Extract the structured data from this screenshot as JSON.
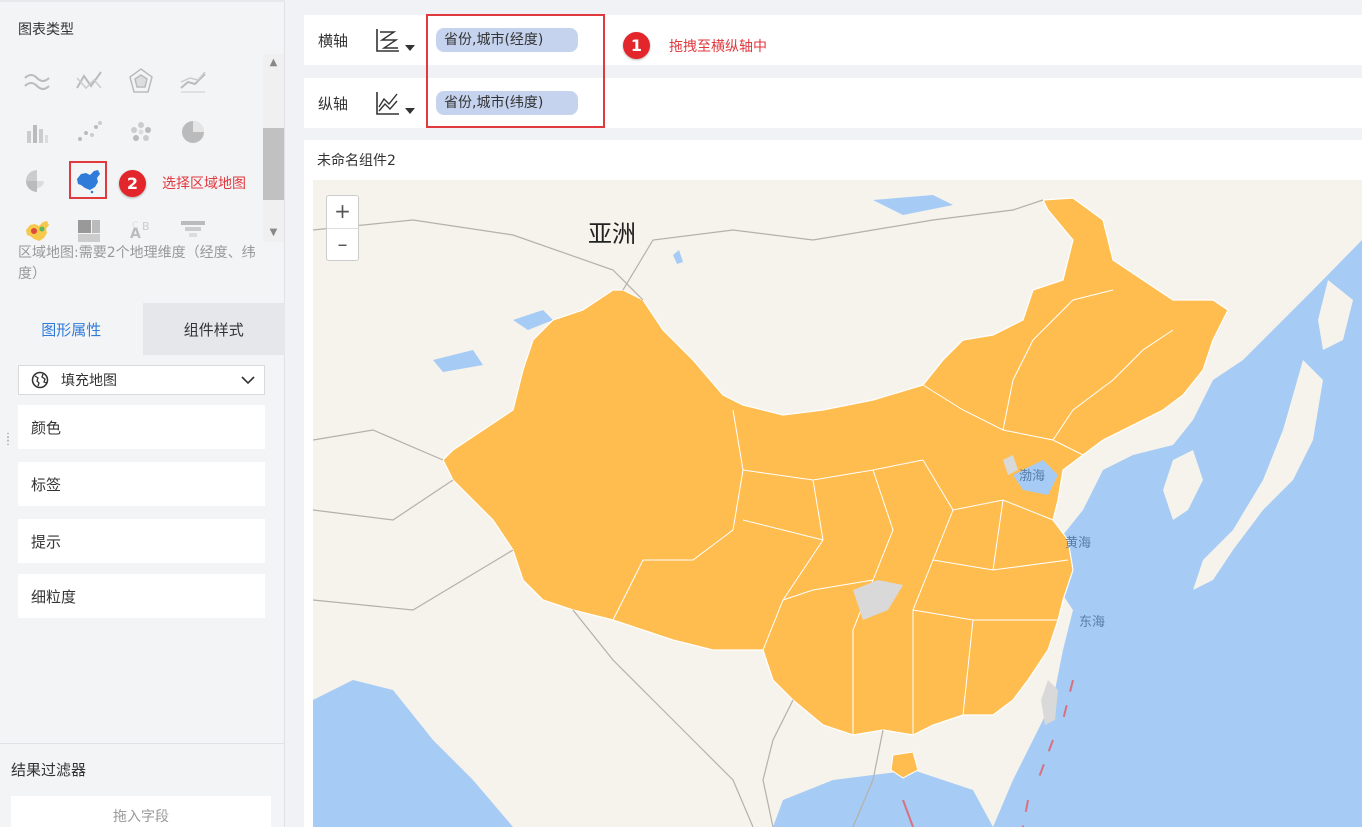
{
  "left_panel": {
    "chart_types_title": "图表类型",
    "chart_types": [
      {
        "name": "multi-line",
        "icon": "multi-line-chart-icon"
      },
      {
        "name": "line-up-down",
        "icon": "line-chart-icon"
      },
      {
        "name": "radar",
        "icon": "radar-chart-icon"
      },
      {
        "name": "area",
        "icon": "area-line-chart-icon"
      },
      {
        "name": "bar",
        "icon": "bar-chart-icon"
      },
      {
        "name": "scatter",
        "icon": "scatter-chart-icon"
      },
      {
        "name": "bubble",
        "icon": "bubble-chart-icon"
      },
      {
        "name": "pie",
        "icon": "pie-chart-icon"
      },
      {
        "name": "rose",
        "icon": "rose-chart-icon"
      },
      {
        "name": "region-map",
        "icon": "china-map-icon",
        "selected": true
      },
      {
        "name": "heat-map",
        "icon": "heat-map-icon"
      },
      {
        "name": "treemap",
        "icon": "treemap-icon"
      },
      {
        "name": "word-cloud",
        "icon": "word-cloud-icon"
      },
      {
        "name": "funnel",
        "icon": "funnel-chart-icon"
      }
    ],
    "hint": "区域地图:需要2个地理维度（经度、纬度）",
    "tabs": [
      {
        "label": "图形属性",
        "active": true
      },
      {
        "label": "组件样式",
        "active": false
      }
    ],
    "map_type_select": "填充地图",
    "properties": [
      "颜色",
      "标签",
      "提示",
      "细粒度"
    ],
    "filter_title": "结果过滤器",
    "filter_drop_placeholder": "拖入字段"
  },
  "axes": {
    "x": {
      "label": "横轴",
      "field": "省份,城市(经度)"
    },
    "y": {
      "label": "纵轴",
      "field": "省份,城市(纬度)"
    }
  },
  "annotations": {
    "step1": {
      "number": "1",
      "text": "拖拽至横纵轴中"
    },
    "step2": {
      "number": "2",
      "text": "选择区域地图"
    }
  },
  "component": {
    "title": "未命名组件2",
    "map_labels": {
      "continent": "亚洲",
      "bohai": "渤海",
      "yellow_sea": "黄海",
      "east_sea": "东海"
    },
    "zoom_in": "+",
    "zoom_out": "–"
  },
  "colors": {
    "accent": "#2f7bd9",
    "annotation_red": "#e0393e",
    "china_fill": "#ffbd4f",
    "sea": "#a6cbf5",
    "land": "#f6f3ec",
    "pill": "#c5d3ef"
  }
}
